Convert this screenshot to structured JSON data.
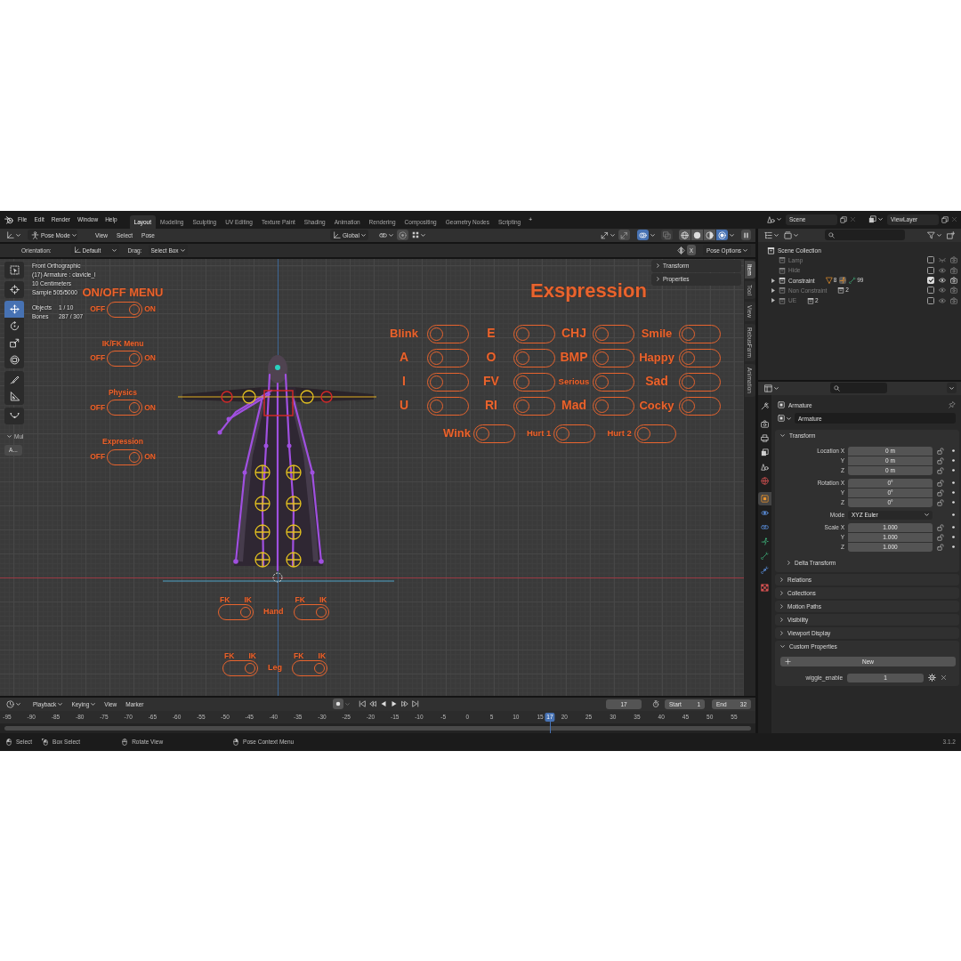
{
  "topbar": {
    "menus": [
      "File",
      "Edit",
      "Render",
      "Window",
      "Help"
    ],
    "workspaces": [
      {
        "label": "Layout",
        "selected": true
      },
      {
        "label": "Modeling",
        "selected": false
      },
      {
        "label": "Sculpting",
        "selected": false
      },
      {
        "label": "UV Editing",
        "selected": false
      },
      {
        "label": "Texture Paint",
        "selected": false
      },
      {
        "label": "Shading",
        "selected": false
      },
      {
        "label": "Animation",
        "selected": false
      },
      {
        "label": "Rendering",
        "selected": false
      },
      {
        "label": "Compositing",
        "selected": false
      },
      {
        "label": "Geometry Nodes",
        "selected": false
      },
      {
        "label": "Scripting",
        "selected": false
      }
    ],
    "add_tab": "+",
    "scene": "Scene",
    "view_layer": "ViewLayer"
  },
  "viewport": {
    "header": {
      "mode": "Pose Mode",
      "menus": [
        "View",
        "Select",
        "Pose"
      ],
      "orientation": "Global",
      "toggles": [
        {
          "kind": "overlays",
          "on": true
        },
        {
          "kind": "xray",
          "on": false
        }
      ],
      "shading": [
        {
          "kind": "wireframe",
          "selected": false
        },
        {
          "kind": "solid",
          "selected": false
        },
        {
          "kind": "material",
          "selected": false
        },
        {
          "kind": "rendered",
          "selected": true
        }
      ]
    },
    "tool_settings": {
      "orientation_label": "Orientation:",
      "orientation": "Default",
      "drag_label": "Drag:",
      "drag": "Select Box",
      "mirror_axis": "X",
      "pose_options": "Pose Options"
    },
    "toolbar": {
      "tool_groups": [
        {
          "tools": [
            {
              "kind": "select",
              "selected": false
            }
          ]
        },
        {
          "tools": [
            {
              "kind": "cursor",
              "selected": false
            }
          ]
        },
        {
          "tools": [
            {
              "kind": "move",
              "selected": true
            },
            {
              "kind": "rotate",
              "selected": false
            },
            {
              "kind": "scale",
              "selected": false
            },
            {
              "kind": "transform",
              "selected": false
            }
          ]
        },
        {
          "tools": [
            {
              "kind": "annotate",
              "selected": false
            },
            {
              "kind": "measure",
              "selected": false
            }
          ]
        },
        {
          "tools": [
            {
              "kind": "relax",
              "selected": false
            }
          ]
        }
      ],
      "tool_panel": {
        "title": "Mul",
        "expanded": true,
        "button": "A..."
      }
    },
    "info": {
      "lines": [
        "Front Orthographic",
        "(17) Armature : clavicle_l",
        "10 Centimeters",
        "Sample 505/5000"
      ],
      "stats": [
        {
          "label": "Objects",
          "value": "1 / 10"
        },
        {
          "label": "Bones",
          "value": "287 / 307"
        }
      ]
    },
    "sidebar": {
      "panels": [
        {
          "title": "Transform",
          "expanded": false
        },
        {
          "title": "Properties",
          "expanded": false
        }
      ],
      "tabs": [
        {
          "label": "Item",
          "selected": true
        },
        {
          "label": "Tool",
          "selected": false
        },
        {
          "label": "View",
          "selected": false
        },
        {
          "label": "RebusFarm",
          "selected": false
        },
        {
          "label": "Animation",
          "selected": false
        }
      ]
    },
    "rig_menu": {
      "heading": "ON/OFF MENU",
      "switches": [
        {
          "off_label": "OFF",
          "on_label": "ON",
          "on": true
        },
        {
          "title": "IK/FK Menu",
          "off_label": "OFF",
          "on_label": "ON",
          "on": true
        },
        {
          "title": "Physics",
          "off_label": "OFF",
          "on_label": "ON",
          "on": true
        },
        {
          "title": "Expression",
          "off_label": "OFF",
          "on_label": "ON",
          "on": true
        }
      ]
    },
    "expression_panel": {
      "title": "Exspression",
      "rows": [
        {
          "items": [
            {
              "label": "Blink",
              "on": false
            },
            {
              "label": "E",
              "on": false
            },
            {
              "label": "CHJ",
              "on": false
            },
            {
              "label": "Smile",
              "on": false
            }
          ]
        },
        {
          "items": [
            {
              "label": "A",
              "on": false
            },
            {
              "label": "O",
              "on": false
            },
            {
              "label": "BMP",
              "on": false
            },
            {
              "label": "Happy",
              "on": false
            }
          ]
        },
        {
          "items": [
            {
              "label": "I",
              "on": false
            },
            {
              "label": "FV",
              "on": false
            },
            {
              "label": "Serious",
              "on": false
            },
            {
              "label": "Sad",
              "on": false
            }
          ]
        },
        {
          "items": [
            {
              "label": "U",
              "on": false
            },
            {
              "label": "RI",
              "on": false
            },
            {
              "label": "Mad",
              "on": false
            },
            {
              "label": "Cocky",
              "on": false
            }
          ]
        }
      ],
      "extra": [
        {
          "label": "Wink",
          "on": false
        },
        {
          "label": "Hurt 1",
          "on": false
        },
        {
          "label": "Hurt 2",
          "on": false
        }
      ]
    },
    "limb_switches": [
      {
        "label": "Hand",
        "switches": [
          {
            "fk_label": "FK",
            "ik_label": "IK",
            "ik": true
          },
          {
            "fk_label": "FK",
            "ik_label": "IK",
            "ik": true
          }
        ]
      },
      {
        "label": "Leg",
        "switches": [
          {
            "fk_label": "FK",
            "ik_label": "IK",
            "ik": true
          },
          {
            "fk_label": "FK",
            "ik_label": "IK",
            "ik": true
          }
        ]
      }
    ]
  },
  "timeline": {
    "menus": [
      {
        "label": "Playback",
        "kind": "dropdown"
      },
      {
        "label": "Keying",
        "kind": "dropdown"
      },
      {
        "label": "View",
        "kind": "menu"
      },
      {
        "label": "Marker",
        "kind": "menu"
      }
    ],
    "current_frame": "17",
    "start_label": "Start",
    "start": "1",
    "end_label": "End",
    "end": "32",
    "ticks": [
      "-95",
      "-90",
      "-85",
      "-80",
      "-75",
      "-70",
      "-65",
      "-60",
      "-55",
      "-50",
      "-45",
      "-40",
      "-35",
      "-30",
      "-25",
      "-20",
      "-15",
      "-10",
      "-5",
      "0",
      "5",
      "10",
      "15",
      "20",
      "25",
      "30",
      "35",
      "40",
      "45",
      "50",
      "55"
    ],
    "playhead": "17"
  },
  "outliner": {
    "root": "Scene Collection",
    "collections": [
      {
        "name": "Lamp",
        "expandable": false,
        "checked": false,
        "visible": false
      },
      {
        "name": "Hide",
        "expandable": false,
        "checked": false,
        "visible": true
      },
      {
        "name": "Constraint",
        "expandable": true,
        "checked": true,
        "visible": true,
        "contents": [
          {
            "kind": "mesh",
            "count": "8"
          },
          {
            "kind": "armature"
          },
          {
            "kind": "bone",
            "count": "99"
          }
        ]
      },
      {
        "name": "Non Constraint",
        "expandable": true,
        "checked": false,
        "visible": true,
        "contents": [
          {
            "kind": "collection",
            "count": "2"
          }
        ]
      },
      {
        "name": "UE",
        "expandable": true,
        "checked": false,
        "visible": true,
        "contents": [
          {
            "kind": "collection",
            "count": "2"
          }
        ]
      }
    ]
  },
  "properties": {
    "tab_groups": [
      {
        "tabs": [
          {
            "kind": "tool",
            "selected": false
          }
        ]
      },
      {
        "tabs": [
          {
            "kind": "render",
            "selected": false
          },
          {
            "kind": "output",
            "selected": false
          },
          {
            "kind": "view_layer",
            "selected": false
          },
          {
            "kind": "scene",
            "selected": false
          },
          {
            "kind": "world",
            "selected": false
          }
        ]
      },
      {
        "tabs": [
          {
            "kind": "object",
            "selected": true
          },
          {
            "kind": "physics",
            "selected": false
          },
          {
            "kind": "object_constraint",
            "selected": false
          },
          {
            "kind": "armature",
            "selected": false
          },
          {
            "kind": "bone",
            "selected": false
          },
          {
            "kind": "bone_constraint",
            "selected": false
          }
        ]
      },
      {
        "tabs": [
          {
            "kind": "texture",
            "selected": false
          }
        ]
      }
    ],
    "context": "Armature",
    "data_block": "Armature",
    "transform": {
      "title": "Transform",
      "expanded": true,
      "groups": [
        {
          "rows": [
            {
              "kind": "number",
              "label": "Location X",
              "value": "0 m"
            },
            {
              "kind": "number",
              "label": "Y",
              "value": "0 m"
            },
            {
              "kind": "number",
              "label": "Z",
              "value": "0 m"
            }
          ]
        },
        {
          "rows": [
            {
              "kind": "number",
              "label": "Rotation X",
              "value": "0°"
            },
            {
              "kind": "number",
              "label": "Y",
              "value": "0°"
            },
            {
              "kind": "number",
              "label": "Z",
              "value": "0°"
            }
          ]
        },
        {
          "rows": [
            {
              "kind": "dropdown",
              "label": "Mode",
              "value": "XYZ Euler"
            }
          ]
        },
        {
          "rows": [
            {
              "kind": "number",
              "label": "Scale X",
              "value": "1.000"
            },
            {
              "kind": "number",
              "label": "Y",
              "value": "1.000"
            },
            {
              "kind": "number",
              "label": "Z",
              "value": "1.000"
            }
          ]
        }
      ],
      "subpanel": {
        "title": "Delta Transform",
        "expanded": false
      }
    },
    "panels": [
      {
        "title": "Relations",
        "expanded": false
      },
      {
        "title": "Collections",
        "expanded": false
      },
      {
        "title": "Motion Paths",
        "expanded": false
      },
      {
        "title": "Visibility",
        "expanded": false
      },
      {
        "title": "Viewport Display",
        "expanded": false
      },
      {
        "title": "Custom Properties",
        "expanded": true,
        "add_label": "New",
        "items": [
          {
            "name": "wiggle_enable",
            "value": "1"
          }
        ]
      }
    ]
  },
  "status_bar": {
    "hints": [
      {
        "kind": "left_click",
        "label": "Select"
      },
      {
        "kind": "left_drag",
        "label": "Box Select"
      },
      {
        "kind": "middle_click",
        "label": "Rotate View"
      },
      {
        "kind": "right_click",
        "label": "Pose Context Menu"
      }
    ],
    "version": "3.1.2"
  }
}
